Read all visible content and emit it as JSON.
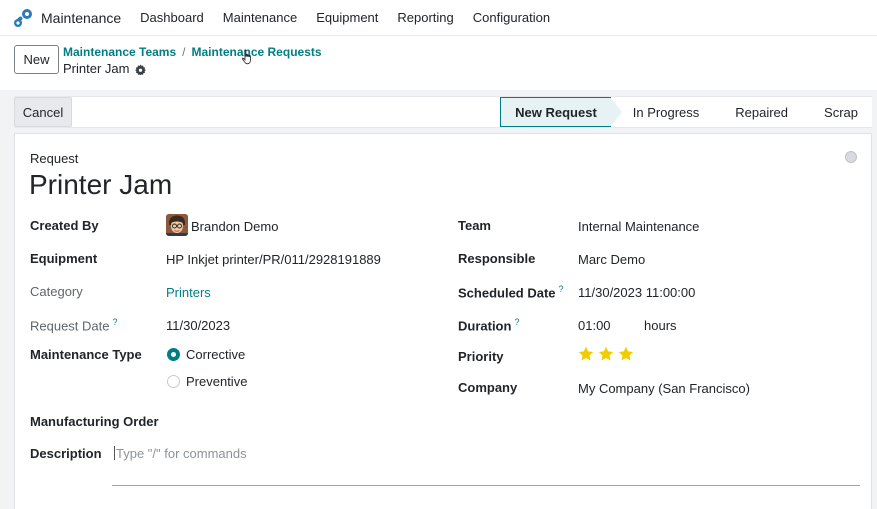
{
  "navbar": {
    "app_name": "Maintenance",
    "logo_icon": "maintenance-app-icon",
    "menu": [
      "Dashboard",
      "Maintenance",
      "Equipment",
      "Reporting",
      "Configuration"
    ]
  },
  "control_panel": {
    "new_label": "New",
    "breadcrumbs": [
      "Maintenance Teams",
      "Maintenance Requests"
    ],
    "breadcrumb_separator": "/",
    "record_name": "Printer Jam"
  },
  "statusbar": {
    "cancel_label": "Cancel",
    "stages": [
      "New Request",
      "In Progress",
      "Repaired",
      "Scrap"
    ],
    "active_stage": "New Request"
  },
  "form": {
    "request_label": "Request",
    "title": "Printer Jam",
    "left": {
      "created_by_label": "Created By",
      "created_by_value": "Brandon Demo",
      "equipment_label": "Equipment",
      "equipment_value": "HP Inkjet printer/PR/011/2928191889",
      "category_label": "Category",
      "category_value": "Printers",
      "request_date_label": "Request Date",
      "request_date_value": "11/30/2023",
      "maintenance_type_label": "Maintenance Type",
      "maintenance_type_options": [
        "Corrective",
        "Preventive"
      ],
      "maintenance_type_selected": "Corrective",
      "manufacturing_order_label": "Manufacturing Order",
      "description_label": "Description",
      "description_placeholder": "Type \"/\" for commands"
    },
    "right": {
      "team_label": "Team",
      "team_value": "Internal Maintenance",
      "responsible_label": "Responsible",
      "responsible_value": "Marc Demo",
      "scheduled_date_label": "Scheduled Date",
      "scheduled_date_value": "11/30/2023 11:00:00",
      "duration_label": "Duration",
      "duration_value": "01:00",
      "duration_unit": "hours",
      "priority_label": "Priority",
      "priority_stars": 3,
      "company_label": "Company",
      "company_value": "My Company (San Francisco)"
    },
    "help_marker": "?"
  },
  "colors": {
    "accent": "#017e84",
    "star": "#f3cc00",
    "logo_orange": "#f38b1c",
    "logo_blue": "#2b7bb9"
  }
}
